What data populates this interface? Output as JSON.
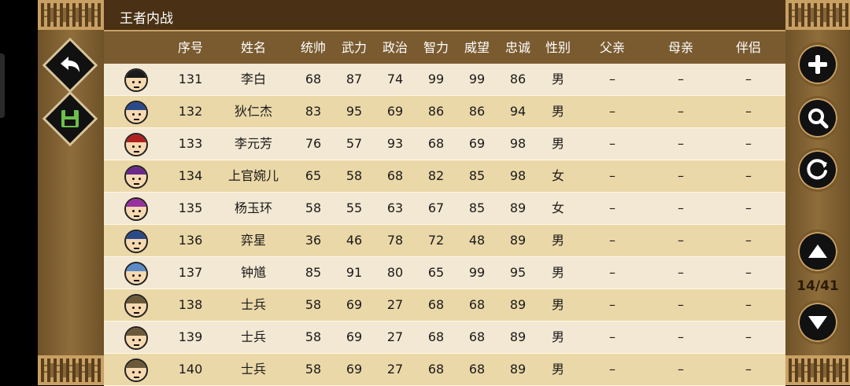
{
  "title": "王者内战",
  "page_indicator": "14/41",
  "columns": {
    "num": "序号",
    "name": "姓名",
    "tongshuai": "统帅",
    "wuli": "武力",
    "zhengzhi": "政治",
    "zhili": "智力",
    "weiwang": "威望",
    "zhongcheng": "忠诚",
    "xingbie": "性别",
    "fuqin": "父亲",
    "muqin": "母亲",
    "banlv": "伴侣"
  },
  "rows": [
    {
      "num": "131",
      "name": "李白",
      "t": "68",
      "w": "87",
      "z": "74",
      "i": "99",
      "p": "99",
      "l": "86",
      "s": "男",
      "f": "–",
      "m": "–",
      "pt": "–",
      "avatar": "avatar-scholar-icon",
      "hat": "#1a1a1a"
    },
    {
      "num": "132",
      "name": "狄仁杰",
      "t": "83",
      "w": "95",
      "z": "69",
      "i": "86",
      "p": "86",
      "l": "94",
      "s": "男",
      "f": "–",
      "m": "–",
      "pt": "–",
      "avatar": "avatar-official-icon",
      "hat": "#2a4a8a"
    },
    {
      "num": "133",
      "name": "李元芳",
      "t": "76",
      "w": "57",
      "z": "93",
      "i": "68",
      "p": "69",
      "l": "98",
      "s": "男",
      "f": "–",
      "m": "–",
      "pt": "–",
      "avatar": "avatar-guard-icon",
      "hat": "#b02020"
    },
    {
      "num": "134",
      "name": "上官婉儿",
      "t": "65",
      "w": "58",
      "z": "68",
      "i": "82",
      "p": "85",
      "l": "98",
      "s": "女",
      "f": "–",
      "m": "–",
      "pt": "–",
      "avatar": "avatar-lady-icon",
      "hat": "#6a2a8a"
    },
    {
      "num": "135",
      "name": "杨玉环",
      "t": "58",
      "w": "55",
      "z": "63",
      "i": "67",
      "p": "85",
      "l": "89",
      "s": "女",
      "f": "–",
      "m": "–",
      "pt": "–",
      "avatar": "avatar-consort-icon",
      "hat": "#9a30a0"
    },
    {
      "num": "136",
      "name": "弈星",
      "t": "36",
      "w": "46",
      "z": "78",
      "i": "72",
      "p": "48",
      "l": "89",
      "s": "男",
      "f": "–",
      "m": "–",
      "pt": "–",
      "avatar": "avatar-youth-icon",
      "hat": "#2a4a8a"
    },
    {
      "num": "137",
      "name": "钟馗",
      "t": "85",
      "w": "91",
      "z": "80",
      "i": "65",
      "p": "99",
      "l": "95",
      "s": "男",
      "f": "–",
      "m": "–",
      "pt": "–",
      "avatar": "avatar-demon-icon",
      "hat": "#5a8ac8"
    },
    {
      "num": "138",
      "name": "士兵",
      "t": "58",
      "w": "69",
      "z": "27",
      "i": "68",
      "p": "68",
      "l": "89",
      "s": "男",
      "f": "–",
      "m": "–",
      "pt": "–",
      "avatar": "avatar-soldier-icon",
      "hat": "#6a5a3a"
    },
    {
      "num": "139",
      "name": "士兵",
      "t": "58",
      "w": "69",
      "z": "27",
      "i": "68",
      "p": "68",
      "l": "89",
      "s": "男",
      "f": "–",
      "m": "–",
      "pt": "–",
      "avatar": "avatar-soldier-icon",
      "hat": "#6a5a3a"
    },
    {
      "num": "140",
      "name": "士兵",
      "t": "58",
      "w": "69",
      "z": "27",
      "i": "68",
      "p": "68",
      "l": "89",
      "s": "男",
      "f": "–",
      "m": "–",
      "pt": "–",
      "avatar": "avatar-soldier-icon",
      "hat": "#6a5a3a"
    }
  ],
  "icons": {
    "back": "back-arrow-icon",
    "save": "save-icon",
    "add": "plus-icon",
    "search": "search-icon",
    "refresh": "refresh-icon",
    "page_up": "triangle-up-icon",
    "page_down": "triangle-down-icon"
  },
  "colors": {
    "header_bg": "#7a5b30",
    "title_bg": "#4a3115",
    "row_odd": "#f3e8d3",
    "row_even": "#ebd8a8",
    "panel": "#8f6d3b",
    "accent": "#c9a064"
  }
}
